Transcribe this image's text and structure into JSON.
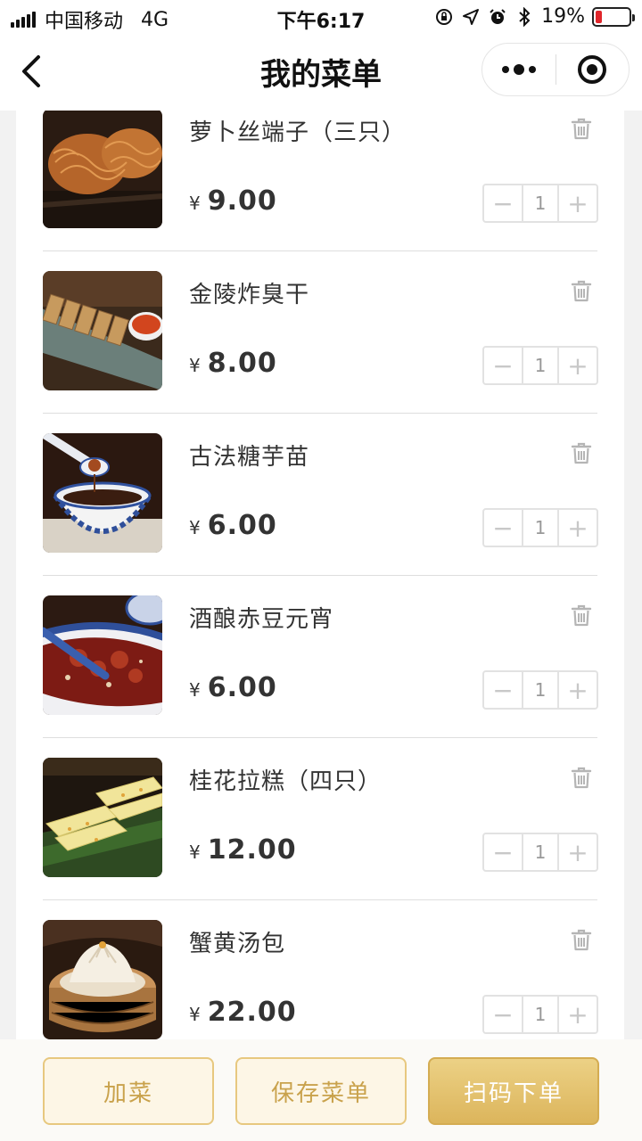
{
  "status_bar": {
    "carrier": "中国移动",
    "network": "4G",
    "time": "下午6:17",
    "battery_percent": "19%",
    "battery_level": 0.19
  },
  "nav": {
    "title": "我的菜单"
  },
  "currency": "¥",
  "items": [
    {
      "name": "萝卜丝端子（三只）",
      "price": "9.00",
      "qty": "1",
      "thumb": "fried-radish-fritters"
    },
    {
      "name": "金陵炸臭干",
      "price": "8.00",
      "qty": "1",
      "thumb": "fried-stinky-tofu"
    },
    {
      "name": "古法糖芋苗",
      "price": "6.00",
      "qty": "1",
      "thumb": "sweet-taro-soup"
    },
    {
      "name": "酒酿赤豆元宵",
      "price": "6.00",
      "qty": "1",
      "thumb": "red-bean-tangyuan"
    },
    {
      "name": "桂花拉糕（四只）",
      "price": "12.00",
      "qty": "1",
      "thumb": "osmanthus-cake"
    },
    {
      "name": "蟹黄汤包",
      "price": "22.00",
      "qty": "1",
      "thumb": "crab-soup-dumpling"
    }
  ],
  "stepper": {
    "minus": "−",
    "plus": "+"
  },
  "bottom_bar": {
    "add_label": "加菜",
    "save_label": "保存菜单",
    "order_label": "扫码下单"
  },
  "colors": {
    "accent": "#dcb55c",
    "accent_light": "#fdf6e6",
    "battery_low": "#e0262b"
  }
}
